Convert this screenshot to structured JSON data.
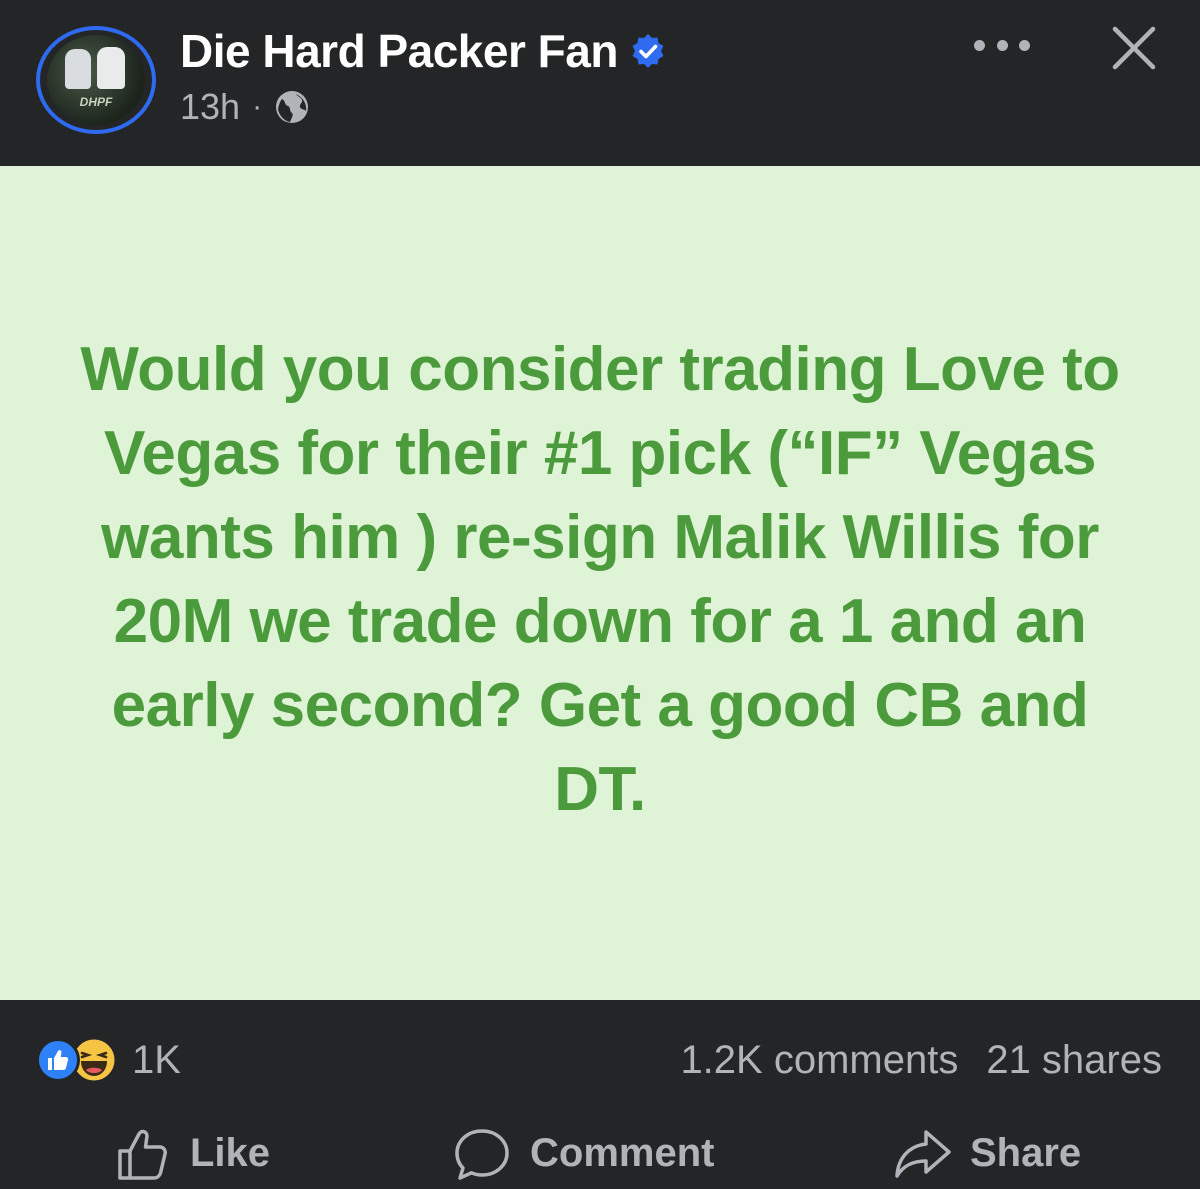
{
  "header": {
    "page_name": "Die Hard Packer Fan",
    "avatar_logo": "DHPF",
    "time": "13h",
    "separator": "·"
  },
  "post": {
    "text": "Would you consider trading Love to Vegas for their #1 pick (“IF” Vegas wants him ) re-sign Malik Willis for 20M we trade down for a 1 and an early second? Get a good CB and DT.",
    "background_color": "#dff3d6",
    "text_color": "#4b9a3c"
  },
  "stats": {
    "reaction_count": "1K",
    "comments": "1.2K comments",
    "shares": "21 shares"
  },
  "actions": {
    "like": "Like",
    "comment": "Comment",
    "share": "Share"
  },
  "colors": {
    "background": "#242526",
    "accent": "#2e6bf0",
    "muted_text": "#b0b3b8"
  }
}
